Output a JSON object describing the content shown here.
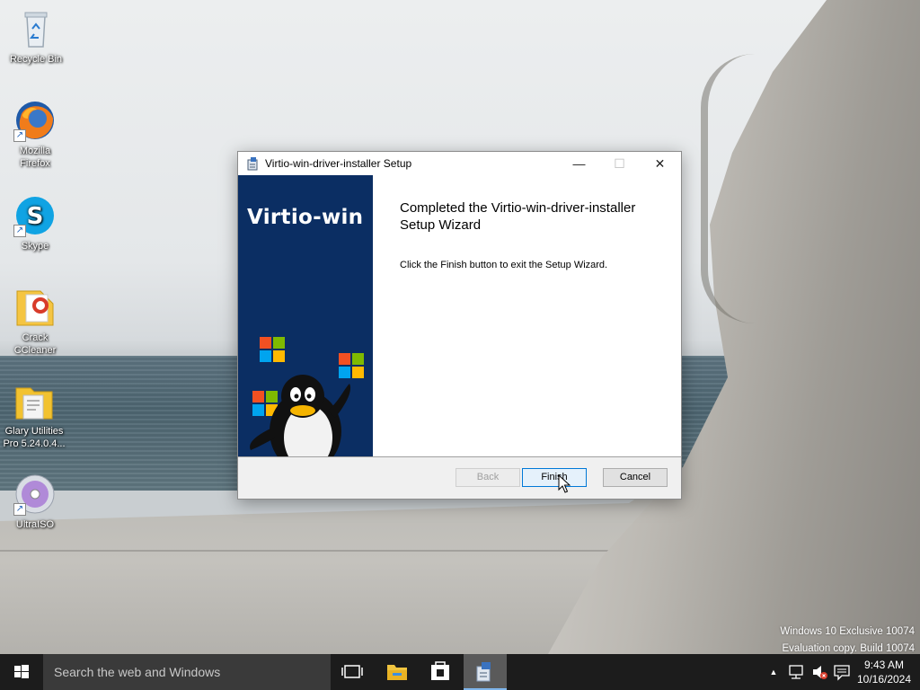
{
  "desktop": {
    "icons": [
      {
        "label": "Recycle Bin",
        "icon": "recycle-bin-icon"
      },
      {
        "label": "Mozilla Firefox",
        "icon": "firefox-icon"
      },
      {
        "label": "Skype",
        "icon": "skype-icon"
      },
      {
        "label": "Crack CCleaner",
        "icon": "ccleaner-icon"
      },
      {
        "label": "Glary Utilities Pro 5.24.0.4...",
        "icon": "glary-utilities-icon"
      },
      {
        "label": "UltraISO",
        "icon": "ultraiso-icon"
      }
    ],
    "watermark": {
      "line1": "Windows 10 Exclusive 10074",
      "line2": "Evaluation copy. Build 10074"
    }
  },
  "dialog": {
    "title": "Virtio-win-driver-installer Setup",
    "brand": "Virtio-win",
    "heading": "Completed the Virtio-win-driver-installer Setup Wizard",
    "body": "Click the Finish button to exit the Setup Wizard.",
    "buttons": {
      "back": "Back",
      "finish": "Finish",
      "cancel": "Cancel"
    },
    "window_controls": {
      "minimize": "—",
      "maximize": "☐",
      "close": "✕"
    }
  },
  "taskbar": {
    "search_placeholder": "Search the web and Windows",
    "items": [
      "task-view-icon",
      "file-explorer-icon",
      "store-icon",
      "setup-installer-icon"
    ],
    "tray": {
      "overflow": "▲",
      "time": "9:43 AM",
      "date": "10/16/2024"
    }
  },
  "colors": {
    "sidebar": "#0b2e63",
    "taskbar": "#1c1c1c",
    "accent": "#0078d7"
  }
}
